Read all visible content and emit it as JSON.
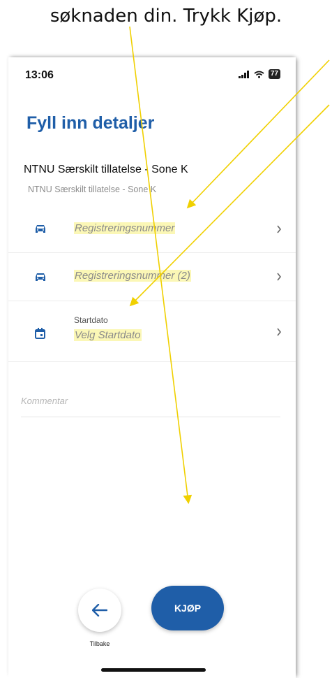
{
  "caption": "søknaden din. Trykk Kjøp.",
  "status_bar": {
    "time": "13:06",
    "battery": "77"
  },
  "page_title": "Fyll inn detaljer",
  "product": {
    "name": "NTNU Særskilt tillatelse - Sone K",
    "subtitle": "NTNU Særskilt tillatelse - Sone K"
  },
  "fields": [
    {
      "label": "Registreringsnummer",
      "icon": "car-icon"
    },
    {
      "label": "Registreringsnummer (2)",
      "icon": "car-icon"
    },
    {
      "small_label": "Startdato",
      "label": "Velg Startdato",
      "icon": "calendar-icon"
    }
  ],
  "comment_placeholder": "Kommentar",
  "buttons": {
    "back_label": "Tilbake",
    "buy_label": "KJØP"
  },
  "colors": {
    "accent": "#1f5ea8",
    "highlight": "#fbf7b6",
    "annotation_arrow": "#f0d000"
  }
}
